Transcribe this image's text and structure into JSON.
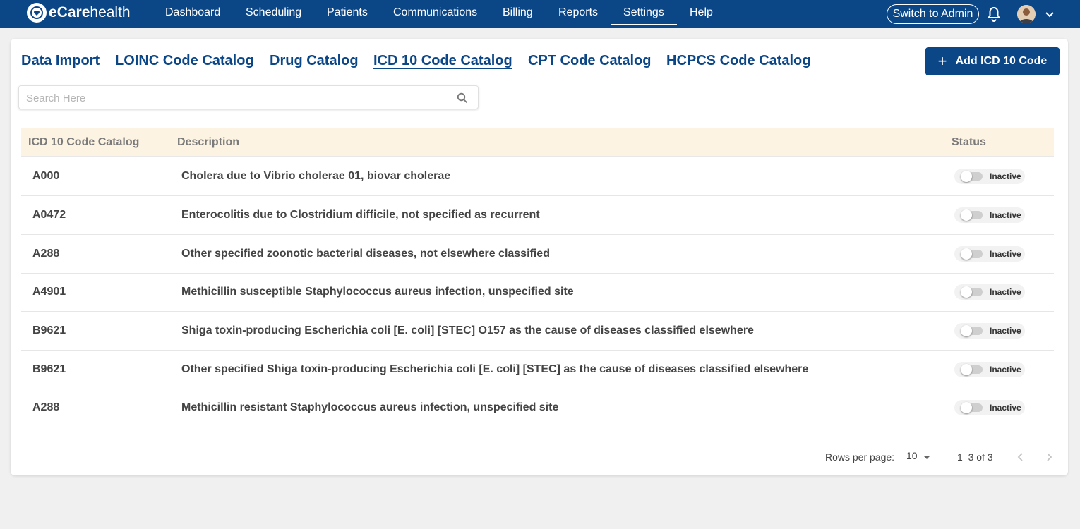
{
  "brand": {
    "name_bold": "eCare",
    "name_regular": "health"
  },
  "nav": {
    "items": [
      {
        "label": "Dashboard"
      },
      {
        "label": "Scheduling"
      },
      {
        "label": "Patients"
      },
      {
        "label": "Communications"
      },
      {
        "label": "Billing"
      },
      {
        "label": "Reports"
      },
      {
        "label": "Settings",
        "active": true
      },
      {
        "label": "Help"
      }
    ],
    "switch_admin": "Switch to Admin",
    "icons": [
      "bell-icon",
      "avatar",
      "chevron-down-icon"
    ]
  },
  "tabs": [
    {
      "label": "Data Import"
    },
    {
      "label": "LOINC Code Catalog"
    },
    {
      "label": "Drug Catalog"
    },
    {
      "label": "ICD 10 Code Catalog",
      "active": true
    },
    {
      "label": "CPT Code Catalog"
    },
    {
      "label": "HCPCS Code Catalog"
    }
  ],
  "add_button": {
    "label": "Add ICD 10 Code",
    "icon": "plus-icon"
  },
  "search": {
    "placeholder": "Search Here",
    "value": "",
    "icon": "search-icon"
  },
  "table": {
    "headers": {
      "code": "ICD 10 Code Catalog",
      "description": "Description",
      "status": "Status"
    },
    "rows": [
      {
        "code": "A000",
        "description": "Cholera due to Vibrio cholerae 01, biovar cholerae",
        "status": "Inactive"
      },
      {
        "code": "A0472",
        "description": "Enterocolitis due to Clostridium difficile, not specified as recurrent",
        "status": "Inactive"
      },
      {
        "code": "A288",
        "description": "Other specified zoonotic bacterial diseases, not elsewhere classified",
        "status": "Inactive"
      },
      {
        "code": "A4901",
        "description": "Methicillin susceptible Staphylococcus aureus infection, unspecified site",
        "status": "Inactive"
      },
      {
        "code": "B9621",
        "description": "Shiga toxin-producing Escherichia coli [E. coli] [STEC] O157 as the cause of diseases classified elsewhere",
        "status": "Inactive"
      },
      {
        "code": "B9621",
        "description": "Other specified Shiga toxin-producing Escherichia coli [E. coli] [STEC] as the cause of diseases classified elsewhere",
        "status": "Inactive"
      },
      {
        "code": "A288",
        "description": "Methicillin resistant Staphylococcus aureus infection, unspecified site",
        "status": "Inactive"
      }
    ]
  },
  "pagination": {
    "rows_per_page_label": "Rows per page:",
    "rows_per_page": "10",
    "range": "1–3 of 3"
  },
  "colors": {
    "primary": "#0b4687",
    "header_row_bg": "#fdf3e3",
    "page_bg": "#f0f0f0"
  }
}
